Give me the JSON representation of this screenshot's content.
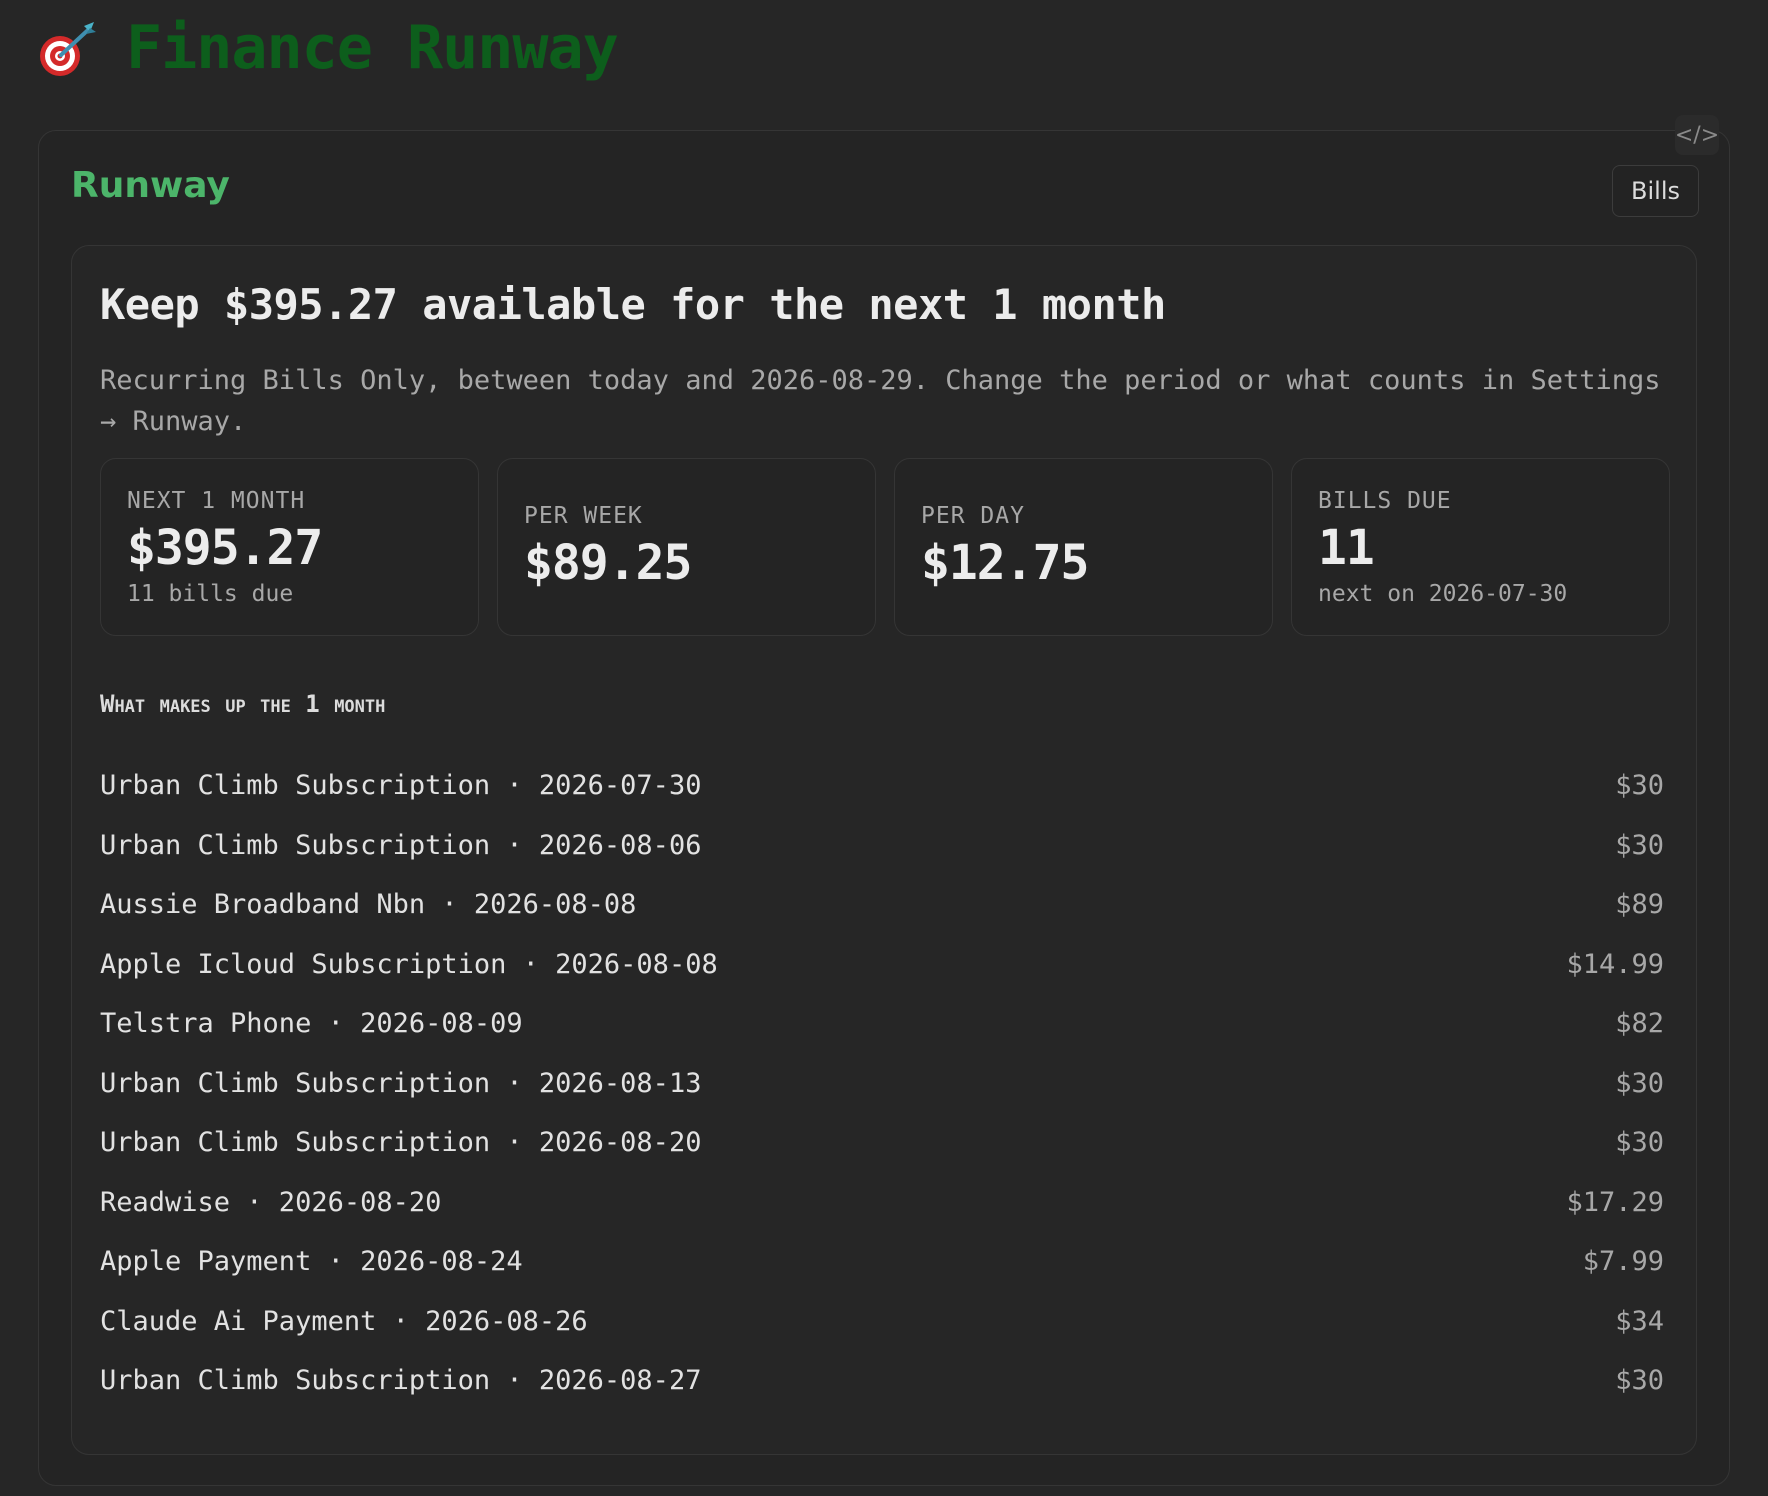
{
  "app": {
    "title": "Finance Runway",
    "icon": "target-dart-icon"
  },
  "panel": {
    "title": "Runway",
    "bills_button": "Bills",
    "code_toggle": "</>"
  },
  "summary": {
    "headline": "Keep $395.27 available for the next 1 month",
    "explanation": "Recurring Bills Only, between today and 2026-08-29. Change the period or what counts in Settings → Runway."
  },
  "stats": [
    {
      "label": "NEXT 1 MONTH",
      "value": "$395.27",
      "sub": "11 bills due"
    },
    {
      "label": "PER WEEK",
      "value": "$89.25",
      "sub": ""
    },
    {
      "label": "PER DAY",
      "value": "$12.75",
      "sub": ""
    },
    {
      "label": "BILLS DUE",
      "value": "11",
      "sub": "next on 2026-07-30"
    }
  ],
  "breakdown": {
    "title": "What makes up the 1 month",
    "items": [
      {
        "label": "Urban Climb Subscription · 2026-07-30",
        "amount": "$30"
      },
      {
        "label": "Urban Climb Subscription · 2026-08-06",
        "amount": "$30"
      },
      {
        "label": "Aussie Broadband Nbn · 2026-08-08",
        "amount": "$89"
      },
      {
        "label": "Apple Icloud Subscription · 2026-08-08",
        "amount": "$14.99"
      },
      {
        "label": "Telstra Phone · 2026-08-09",
        "amount": "$82"
      },
      {
        "label": "Urban Climb Subscription · 2026-08-13",
        "amount": "$30"
      },
      {
        "label": "Urban Climb Subscription · 2026-08-20",
        "amount": "$30"
      },
      {
        "label": "Readwise · 2026-08-20",
        "amount": "$17.29"
      },
      {
        "label": "Apple Payment · 2026-08-24",
        "amount": "$7.99"
      },
      {
        "label": "Claude Ai Payment · 2026-08-26",
        "amount": "$34"
      },
      {
        "label": "Urban Climb Subscription · 2026-08-27",
        "amount": "$30"
      }
    ]
  },
  "colors": {
    "background": "#262626",
    "app_title": "#0d5e1c",
    "panel_title": "#4cb56a"
  }
}
